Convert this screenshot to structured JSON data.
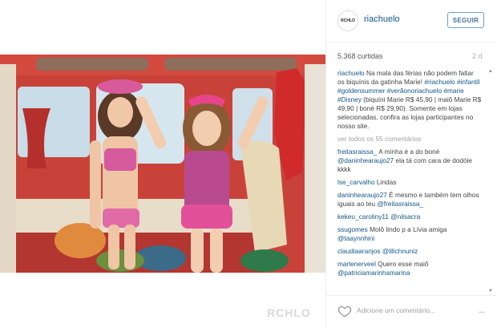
{
  "header": {
    "avatar_text": "RCHLO",
    "username": "riachuelo",
    "follow_label": "SEGUIR"
  },
  "stats": {
    "likes": "5.368 curtidas",
    "ago": "2 d"
  },
  "caption": {
    "user": "riachuelo",
    "text_1": "Na mala das férias não podem faltar os biquínis da gatinha Marie! ",
    "tags_1": "#riachuelo #infantil #goldensummer #verãonoriachuelo #marie #Disney",
    "text_2": "(biquíni Marie R$ 45,90 | maiô Marie R$ 49,90 | boné R$ 29,90). Somente em lojas selecionadas, confira as lojas participantes no nosso site."
  },
  "view_all": "ver todos os 55 comentários",
  "comments": [
    {
      "user": "freitasraissa_",
      "text": "A minha é a do boné ",
      "mention": "@daninhearaujo27",
      "tail": " ela tá com cara de dodóie kkkk"
    },
    {
      "user": "lse_carvalho",
      "text": "Lindas",
      "mention": "",
      "tail": ""
    },
    {
      "user": "daninhearaujo27",
      "text": "É mesmo e também tem olhos iguais ao teu ",
      "mention": "@freitasraissa_",
      "tail": ""
    },
    {
      "user": "kekeu_caroliny11",
      "text": "",
      "mention": "@nilsacra",
      "tail": ""
    },
    {
      "user": "ssugomes",
      "text": "Molô lindo p a Lívia amiga ",
      "mention": "@taaynnhini",
      "tail": ""
    },
    {
      "user": "claudiaaranjos",
      "text": "",
      "mention": "@lilichnuniz",
      "tail": ""
    },
    {
      "user": "marlenerveel",
      "text": "Quero esse maiô ",
      "mention": "@patriciamarinhamarina",
      "tail": ""
    }
  ],
  "footer": {
    "add_comment_placeholder": "Adicione um comentário...",
    "more": "..."
  },
  "photo": {
    "watermark": "RCHLO"
  }
}
